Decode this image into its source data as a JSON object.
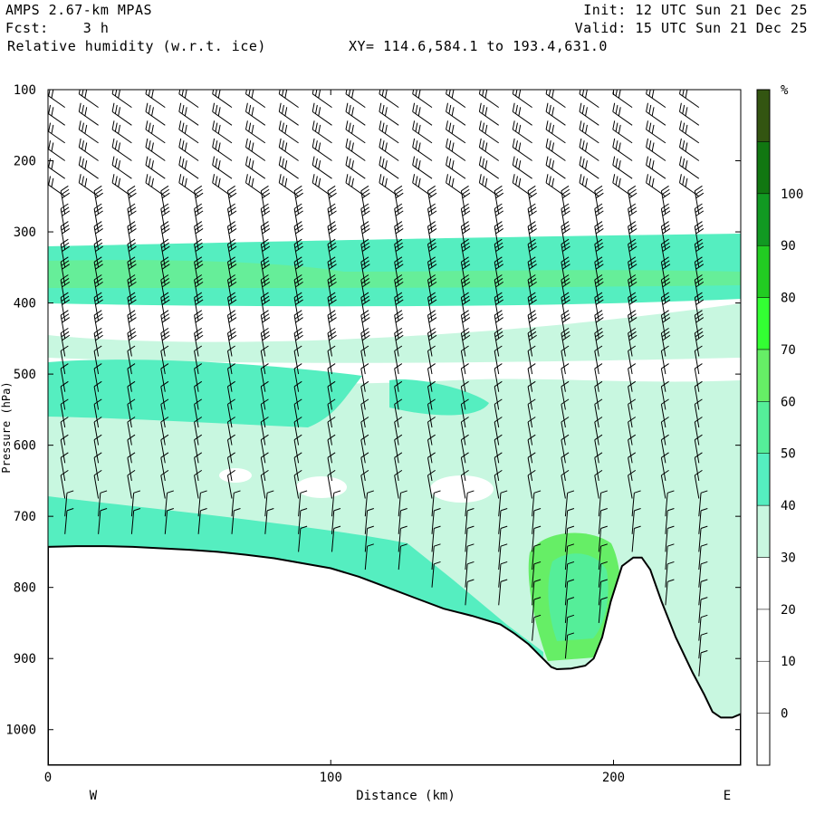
{
  "header": {
    "model": "AMPS 2.67-km MPAS",
    "fcst": "Fcst:    3 h",
    "field": "Relative humidity (w.r.t. ice)",
    "xy": "XY= 114.6,584.1 to 193.4,631.0",
    "init": "Init: 12 UTC Sun 21 Dec 25",
    "valid": "Valid: 15 UTC Sun 21 Dec 25"
  },
  "chart_data": {
    "type": "area",
    "xlabel": "Distance (km)",
    "ylabel": "Pressure (hPa)",
    "xlim": [
      0,
      245
    ],
    "ylim": [
      1050,
      100
    ],
    "y_scale": "linear-inverted",
    "x_ticks": [
      "0",
      "100",
      "200"
    ],
    "y_ticks": [
      "100",
      "200",
      "300",
      "400",
      "500",
      "600",
      "700",
      "800",
      "900",
      "1000"
    ],
    "x_end_labels": [
      "W",
      "E"
    ],
    "colorbar": {
      "unit": "%",
      "labels": [
        "0",
        "10",
        "20",
        "30",
        "40",
        "50",
        "60",
        "70",
        "80",
        "90",
        "100"
      ],
      "colors": [
        "#ffffff",
        "#ffffff",
        "#ffffff",
        "#ffffff",
        "#c8f7e0",
        "#55eec0",
        "#55ee99",
        "#66ee66",
        "#33ff33",
        "#22cc22",
        "#119922",
        "#117711",
        "#335511"
      ]
    },
    "terrain_hPa": [
      [
        0,
        743
      ],
      [
        10,
        742
      ],
      [
        20,
        742
      ],
      [
        30,
        743
      ],
      [
        40,
        745
      ],
      [
        50,
        747
      ],
      [
        60,
        750
      ],
      [
        70,
        754
      ],
      [
        80,
        759
      ],
      [
        90,
        766
      ],
      [
        100,
        773
      ],
      [
        110,
        785
      ],
      [
        120,
        800
      ],
      [
        130,
        815
      ],
      [
        140,
        830
      ],
      [
        150,
        840
      ],
      [
        160,
        852
      ],
      [
        165,
        865
      ],
      [
        170,
        880
      ],
      [
        175,
        900
      ],
      [
        178,
        912
      ],
      [
        180,
        915
      ],
      [
        185,
        914
      ],
      [
        190,
        910
      ],
      [
        193,
        900
      ],
      [
        196,
        870
      ],
      [
        199,
        820
      ],
      [
        203,
        770
      ],
      [
        207,
        758
      ],
      [
        210,
        758
      ],
      [
        213,
        775
      ],
      [
        217,
        820
      ],
      [
        222,
        870
      ],
      [
        228,
        920
      ],
      [
        232,
        950
      ],
      [
        235,
        975
      ],
      [
        238,
        983
      ],
      [
        242,
        983
      ],
      [
        245,
        978
      ]
    ],
    "humidity_regions": [
      {
        "level": "30-40",
        "color": "#c8f7e0",
        "description": "background moist layer"
      },
      {
        "level": "40-50",
        "color": "#55eec0",
        "layer_hPa": [
          320,
          395
        ]
      },
      {
        "level": "50-60",
        "color": "#66ee99",
        "layer_hPa": [
          345,
          370
        ]
      },
      {
        "level": "40-50",
        "color": "#55eec0",
        "layer_hPa": [
          480,
          575
        ]
      },
      {
        "level": "40-50",
        "color": "#55eec0",
        "layer_hPa": [
          690,
          745
        ]
      },
      {
        "level": "50-70",
        "color": "#66ee66",
        "description": "moist pocket near terrain",
        "x": [
          175,
          198
        ],
        "hPa": [
          720,
          900
        ]
      }
    ],
    "wind_barbs": "shown on grid (~10 km by ~25 hPa)"
  }
}
